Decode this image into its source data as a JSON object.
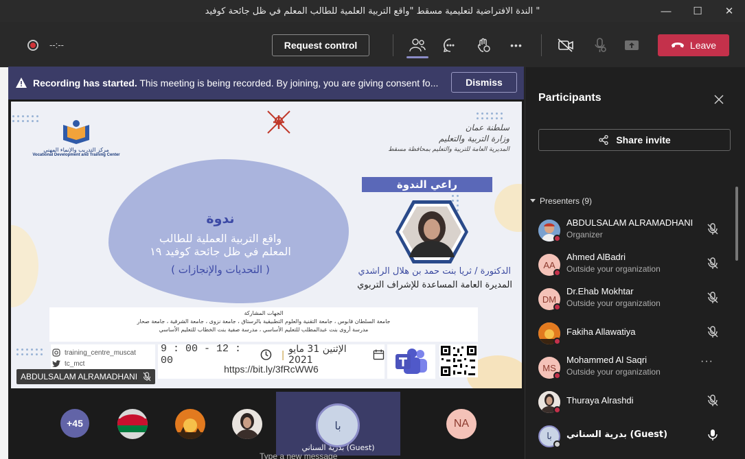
{
  "window": {
    "title": "الندة الافتراضية لتعليمية مسقط \"واقع التربية العلمية للطالب المعلم في ظل جائحة كوفيد \"",
    "minimize_glyph": "—",
    "maximize_glyph": "☐",
    "close_glyph": "✕"
  },
  "toolbar": {
    "timer": "--:--",
    "request_control_label": "Request control",
    "more_glyph": "•••",
    "leave_label": "Leave"
  },
  "banner": {
    "bold": "Recording has started.",
    "message": " This meeting is being recorded. By joining, you are giving consent fo...",
    "dismiss_label": "Dismiss"
  },
  "slide": {
    "logo_caption_ar": "مركز التدريب والإنماء المهني",
    "logo_caption_en": "Vocational Development and Training Center",
    "ministry_line1": "سلطنة عمان",
    "ministry_line2": "وزارة التربية والتعليم",
    "ministry_line3": "المديرية العامة للتربية والتعليم بمحافظة مسقط",
    "sponsor_title": "راعي الندوة",
    "speaker_name": "الدكتورة / ثريا بنت حمد بن هلال الراشدي",
    "speaker_role": "المديرة العامة المساعدة للإشراف التربوي",
    "seminar_label": "ندوة",
    "topic_line1": "واقع التربية العملية للطالب",
    "topic_line2": "المعلم في ظل جائحة كوفيد ١٩",
    "topic_line3": "( التحديات والإنجازات )",
    "parties_heading": "الجهات المشاركة",
    "parties_line1": "جامعة السلطان قابوس ، جامعة التقنية والعلوم التطبيقية بالرستاق ، جامعة نزوى ، جامعة الشرقية ، جامعة صحار",
    "parties_line2": "مدرسة أروى بنت عبدالمطلب للتعليم الأساسي ، مدرسة صفية بنت الخطاب للتعليم الأساسي",
    "instagram": "training_centre_muscat",
    "twitter": "tc_mct",
    "time": "9 : 00 - 12 : 00",
    "date": "الإثنين 31 مايو 2021",
    "url": "https://bit.ly/3fRcWW6"
  },
  "tile_label": "ABDULSALAM ALRAMADHANI",
  "roster": {
    "more_count": "+45",
    "guest_initials": "با",
    "guest_label": "بدرية السناني (Guest)",
    "na_initials": "NA",
    "chat_peek": "Type a new message"
  },
  "panel": {
    "title": "Participants",
    "share_invite_label": "Share invite",
    "presenters_label": "Presenters (9)",
    "participants": [
      {
        "name": "ABDULSALAM ALRAMADHANI",
        "sub": "Organizer",
        "initials": ""
      },
      {
        "name": "Ahmed AlBadri",
        "sub": "Outside your organization",
        "initials": "AA"
      },
      {
        "name": "Dr.Ehab Mokhtar",
        "sub": "Outside your organization",
        "initials": "DM"
      },
      {
        "name": "Fakiha Allawatiya",
        "sub": "",
        "initials": ""
      },
      {
        "name": "Mohammed Al Saqri",
        "sub": "Outside your organization",
        "initials": "MS"
      },
      {
        "name": "Thuraya Alrashdi",
        "sub": "",
        "initials": ""
      },
      {
        "name": "بدرية السناني (Guest)",
        "sub": "",
        "initials": "با"
      }
    ],
    "more_glyph": "···"
  },
  "colors": {
    "accent": "#6264a7",
    "leave": "#c4314b",
    "banner": "#3b3c67"
  }
}
